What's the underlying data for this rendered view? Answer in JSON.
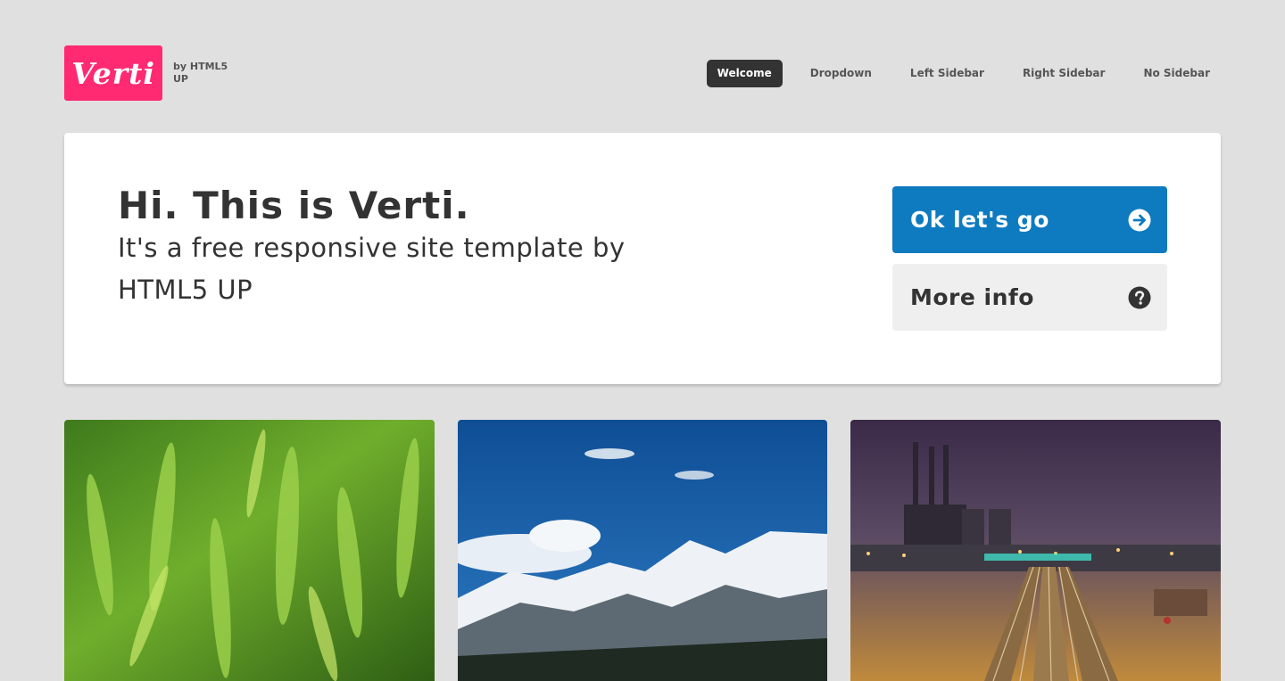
{
  "header": {
    "logo_text": "Verti",
    "logo_sub": "by HTML5 UP",
    "logo_color": "#ff2a72"
  },
  "nav": {
    "items": [
      {
        "label": "Welcome",
        "active": true
      },
      {
        "label": "Dropdown",
        "active": false
      },
      {
        "label": "Left Sidebar",
        "active": false
      },
      {
        "label": "Right Sidebar",
        "active": false
      },
      {
        "label": "No Sidebar",
        "active": false
      }
    ]
  },
  "banner": {
    "title": "Hi. This is Verti.",
    "subtitle": "It's a free responsive site template by HTML5 UP",
    "primary_button": {
      "label": "Ok let's go",
      "icon": "arrow-right-circle-icon",
      "color": "#0e7abf"
    },
    "secondary_button": {
      "label": "More info",
      "icon": "question-circle-icon",
      "color": "#efefef"
    }
  },
  "features": [
    {
      "image": "wheat-field-photo"
    },
    {
      "image": "snowy-mountains-photo"
    },
    {
      "image": "city-railway-night-photo"
    }
  ]
}
